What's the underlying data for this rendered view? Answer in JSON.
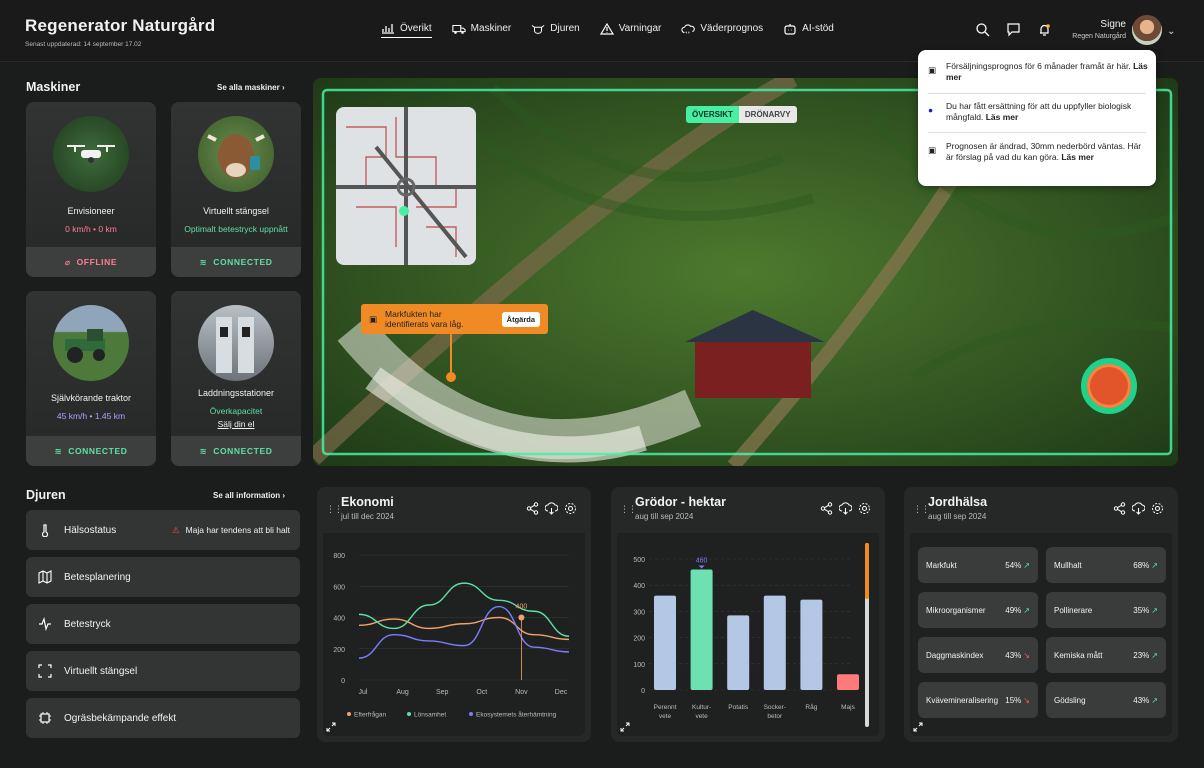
{
  "header": {
    "title": "Regenerator Naturgård",
    "updated": "Senast uppdaterad:  14 september 17.02",
    "nav": [
      {
        "label": "Överikt",
        "icon": "chart-icon"
      },
      {
        "label": "Maskiner",
        "icon": "truck-icon"
      },
      {
        "label": "Djuren",
        "icon": "cow-icon"
      },
      {
        "label": "Varningar",
        "icon": "warning-icon"
      },
      {
        "label": "Väderprognos",
        "icon": "cloud-icon"
      },
      {
        "label": "AI-stöd",
        "icon": "robot-icon"
      }
    ],
    "user": {
      "name": "Signe",
      "farm": "Regen Naturgård"
    }
  },
  "notifications": [
    {
      "text": "Försäljningsprognos för 6 månader framåt är här.",
      "link": "Läs mer",
      "icon": "robot-icon"
    },
    {
      "text": "Du har fått ersättning för att du uppfyller biologisk mångfald.",
      "link": "Läs mer",
      "icon": "dot-icon"
    },
    {
      "text": "Prognosen är ändrad, 30mm nederbörd väntas. Här är förslag på vad du kan göra.",
      "link": "Läs mer",
      "icon": "robot-icon"
    }
  ],
  "machines": {
    "title": "Maskiner",
    "link": "Se alla maskiner",
    "cards": [
      {
        "name": "Envisioneer",
        "stat1": "0 km/h",
        "stat2": "0 km",
        "status": "OFFLINE"
      },
      {
        "name": "Virtuellt stängsel",
        "stat1": "Optimalt betestryck uppnått",
        "status": "CONNECTED"
      },
      {
        "name": "Självkörande traktor",
        "stat1": "45 km/h",
        "stat2": "1.45 km",
        "status": "CONNECTED"
      },
      {
        "name": "Laddningsstationer",
        "stat1": "Överkapacitet",
        "stat2": "Sälj din el",
        "status": "CONNECTED"
      }
    ]
  },
  "hero": {
    "toggle": [
      "ÖVERSIKT",
      "DRÖNARVY"
    ],
    "alert": "Markfukten har identifierats vara låg.",
    "alert_action": "Åtgärda"
  },
  "animals": {
    "title": "Djuren",
    "link": "Se all information",
    "health": "Hälsostatus",
    "health_alert": "Maja har tendens att bli halt",
    "items": [
      {
        "label": "Betesplanering",
        "icon": "map-icon"
      },
      {
        "label": "Betestryck",
        "icon": "pulse-icon"
      },
      {
        "label": "Virtuellt stängsel",
        "icon": "fence-icon"
      },
      {
        "label": "Ogräsbekämpande effekt",
        "icon": "chip-icon"
      }
    ]
  },
  "economy": {
    "title": "Ekonomi",
    "subtitle": "jul till dec 2024"
  },
  "crops": {
    "title": "Grödor - hektar",
    "subtitle": "aug till sep 2024"
  },
  "soil": {
    "title": "Jordhälsa",
    "subtitle": "aug till sep 2024",
    "items": [
      {
        "label": "Markfukt",
        "value": "54%",
        "trend": "up"
      },
      {
        "label": "Mullhalt",
        "value": "68%",
        "trend": "up"
      },
      {
        "label": "Mikroorganismer",
        "value": "49%",
        "trend": "up"
      },
      {
        "label": "Pollinerare",
        "value": "35%",
        "trend": "up"
      },
      {
        "label": "Daggmaskindex",
        "value": "43%",
        "trend": "down"
      },
      {
        "label": "Kemiska mått",
        "value": "23%",
        "trend": "up"
      },
      {
        "label": "Kvävemineralisering",
        "value": "15%",
        "trend": "down"
      },
      {
        "label": "Gödsling",
        "value": "43%",
        "trend": "up"
      }
    ]
  },
  "chart_data": [
    {
      "type": "line",
      "categories": [
        "Jul",
        "Aug",
        "Sep",
        "Oct",
        "Nov",
        "Dec"
      ],
      "ylim": [
        0,
        800
      ],
      "yticks": [
        0,
        200,
        400,
        600,
        800
      ],
      "series": [
        {
          "name": "Efterfrågan",
          "color": "#f0a36a",
          "values": [
            350,
            390,
            330,
            360,
            400,
            290,
            260
          ]
        },
        {
          "name": "Lönsamhet",
          "color": "#5fe0a4",
          "values": [
            420,
            330,
            480,
            620,
            510,
            440,
            280
          ]
        },
        {
          "name": "Ekosystemets återhämtning",
          "color": "#7b7dff",
          "values": [
            140,
            290,
            250,
            220,
            470,
            210,
            180
          ]
        }
      ],
      "annotation": {
        "x": "Nov",
        "value": "400"
      }
    },
    {
      "type": "bar",
      "categories": [
        "Perenntvete",
        "Kulturvete",
        "Potatis",
        "Sockerbetor",
        "Råg",
        "Majs"
      ],
      "ticklabels": [
        [
          "Perennt",
          "vete"
        ],
        [
          "Kultur-",
          "vete"
        ],
        [
          "Potatis"
        ],
        [
          "Socker-",
          "betor"
        ],
        [
          "Råg"
        ],
        [
          "Majs"
        ]
      ],
      "values": [
        360,
        460,
        285,
        360,
        345,
        60
      ],
      "ylim": [
        0,
        500
      ],
      "yticks": [
        0,
        100,
        200,
        300,
        400,
        500
      ],
      "highlight": "460",
      "colors": [
        "#b4c8e6",
        "#6fe0b2",
        "#b4c8e6",
        "#b4c8e6",
        "#b4c8e6",
        "#ff7a7a"
      ]
    }
  ]
}
